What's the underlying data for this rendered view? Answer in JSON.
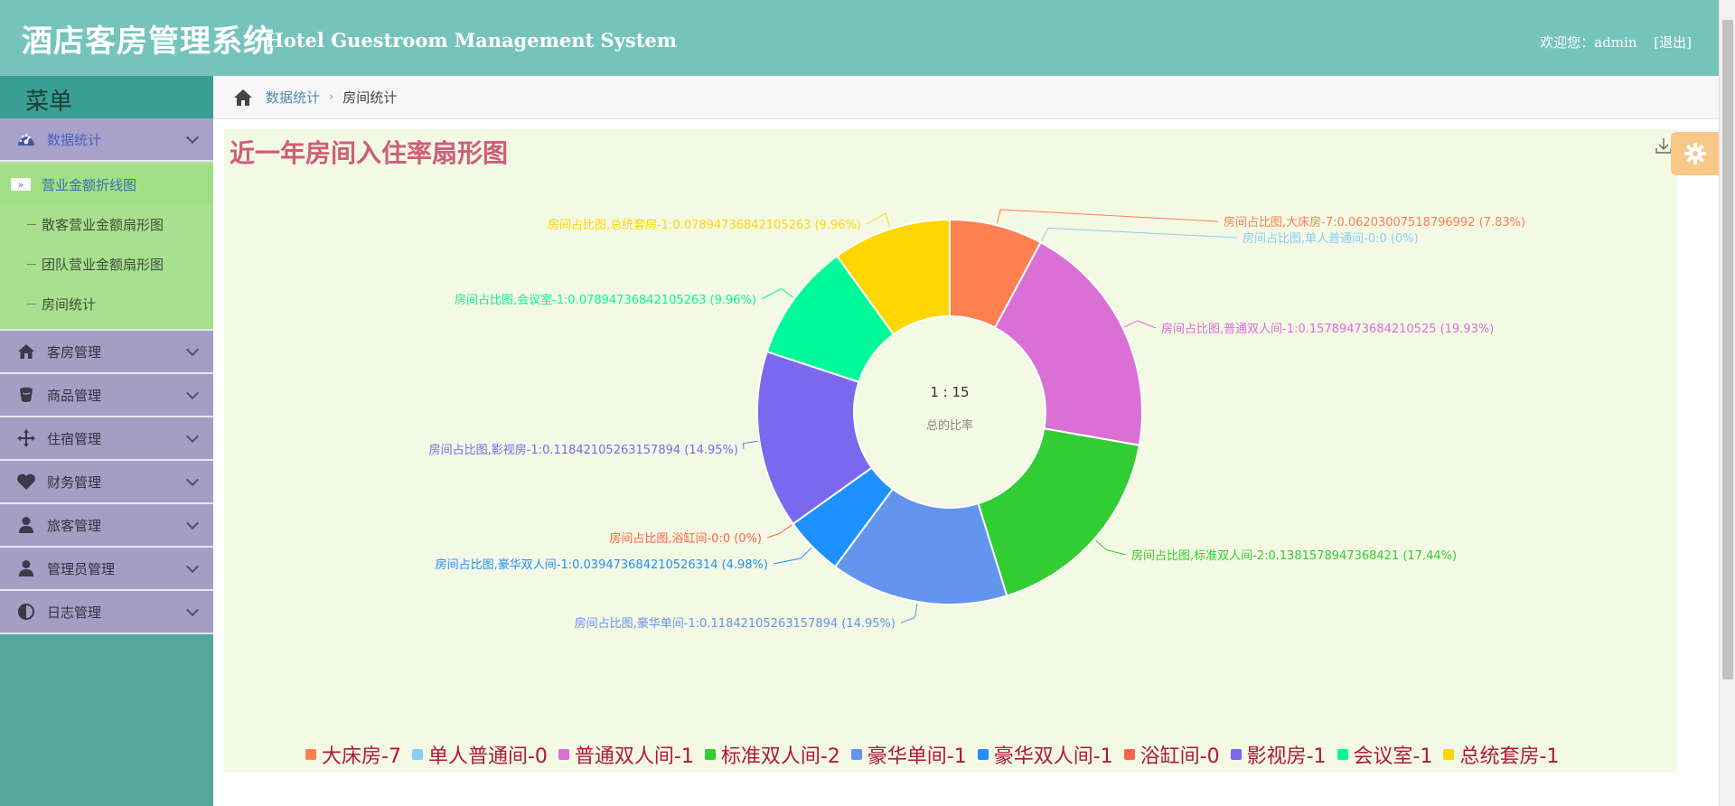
{
  "header": {
    "title": "酒店客房管理系统",
    "subtitle": "Hotel Guestroom Management System",
    "welcome": "欢迎您：admin",
    "logout": "[退出]",
    "bg_color": "#75c4bc"
  },
  "sidebar": {
    "menu_title": "菜单",
    "groups": [
      {
        "label": "数据统计",
        "icon": "dashboard-icon",
        "open": true
      },
      {
        "label": "客房管理",
        "icon": "home-icon"
      },
      {
        "label": "商品管理",
        "icon": "cup-icon"
      },
      {
        "label": "住宿管理",
        "icon": "move-icon"
      },
      {
        "label": "财务管理",
        "icon": "heart-icon"
      },
      {
        "label": "旅客管理",
        "icon": "user-icon"
      },
      {
        "label": "管理员管理",
        "icon": "user-icon"
      },
      {
        "label": "日志管理",
        "icon": "half-circle-icon"
      }
    ],
    "sub_items": [
      {
        "label": "营业金额折线图",
        "active": true
      },
      {
        "label": "散客营业金额扇形图"
      },
      {
        "label": "团队营业金额扇形图"
      },
      {
        "label": "房间统计"
      }
    ]
  },
  "breadcrumb": {
    "parent": "数据统计",
    "current": "房间统计"
  },
  "chart_data": {
    "type": "pie",
    "title": "近一年房间入住率扇形图",
    "center_value": "1 : 15",
    "center_label": "总的比率",
    "legend_position": "bottom",
    "slices": [
      {
        "legend": "大床房-7",
        "label": "房间占比图,大床房-7:0.06203007518796992  (7.83%)",
        "value": 7.83,
        "color": "#ff7f50"
      },
      {
        "legend": "单人普通间-0",
        "label": "房间占比图,单人普通间-0:0  (0%)",
        "value": 0,
        "color": "#87cefa"
      },
      {
        "legend": "普通双人间-1",
        "label": "房间占比图,普通双人间-1:0.15789473684210525  (19.93%)",
        "value": 19.93,
        "color": "#da70d6"
      },
      {
        "legend": "标准双人间-2",
        "label": "房间占比图,标准双人间-2:0.1381578947368421  (17.44%)",
        "value": 17.44,
        "color": "#32cd32"
      },
      {
        "legend": "豪华单间-1",
        "label": "房间占比图,豪华单间-1:0.11842105263157894  (14.95%)",
        "value": 14.95,
        "color": "#6495ed"
      },
      {
        "legend": "豪华双人间-1",
        "label": "房间占比图,豪华双人间-1:0.039473684210526314  (4.98%)",
        "value": 4.98,
        "color": "#1e90ff"
      },
      {
        "legend": "浴缸间-0",
        "label": "房间占比图,浴缸间-0:0  (0%)",
        "value": 0,
        "color": "#ff6347"
      },
      {
        "legend": "影视房-1",
        "label": "房间占比图,影视房-1:0.11842105263157894  (14.95%)",
        "value": 14.95,
        "color": "#7b68ee"
      },
      {
        "legend": "会议室-1",
        "label": "房间占比图,会议室-1:0.07894736842105263  (9.96%)",
        "value": 9.96,
        "color": "#00fa9a"
      },
      {
        "legend": "总统套房-1",
        "label": "房间占比图,总统套房-1:0.07894736842105263  (9.96%)",
        "value": 9.96,
        "color": "#ffd700"
      }
    ]
  },
  "colors": {
    "sidebar_bg": "#55a89c",
    "menu_group_bg": "#a49dc4",
    "submenu_bg": "#a8e08e",
    "chart_bg": "#f4f9e4",
    "title_color": "#d05d78",
    "legend_text": "#b0173d",
    "gear_bg": "#f7c887"
  }
}
